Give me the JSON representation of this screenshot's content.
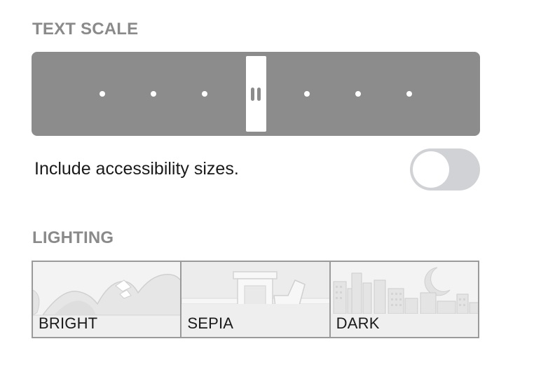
{
  "text_scale": {
    "heading": "TEXT SCALE",
    "step_count": 7,
    "selected_step": 4,
    "icons": {
      "dot": "scale-step-dot-icon",
      "handle": "slider-grip-icon"
    }
  },
  "accessibility": {
    "label": "Include accessibility sizes.",
    "enabled": false
  },
  "lighting": {
    "heading": "LIGHTING",
    "options": [
      {
        "label": "BRIGHT",
        "icon": "bright-scene-icon"
      },
      {
        "label": "SEPIA",
        "icon": "sepia-scene-icon"
      },
      {
        "label": "DARK",
        "icon": "dark-scene-icon"
      }
    ]
  },
  "colors": {
    "heading": "#8a8a8a",
    "track": "#8c8c8c",
    "toggle_off": "#d0d2d6",
    "tile_border": "#9a9a9a"
  }
}
